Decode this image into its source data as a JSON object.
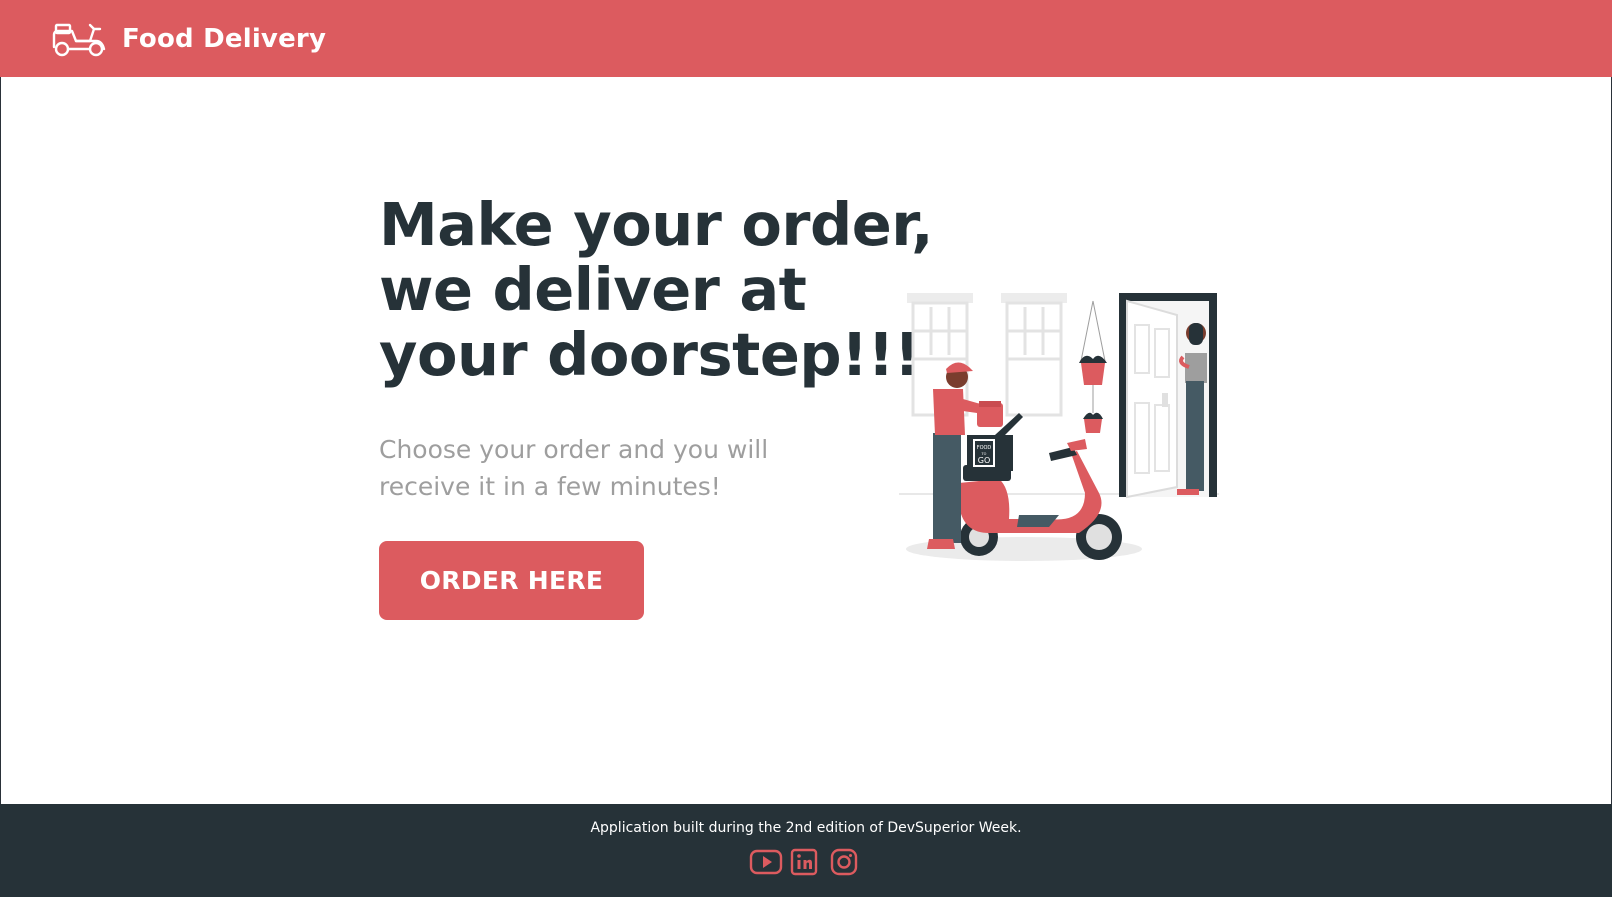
{
  "navbar": {
    "brand": "Food Delivery",
    "logo_icon": "scooter-icon"
  },
  "hero": {
    "title_lines": [
      "Make your order,",
      "we deliver at",
      "your doorstep!!!"
    ],
    "subtitle_lines": [
      "Choose your order and you will",
      "receive it in a few minutes!"
    ],
    "button_label": "ORDER HERE",
    "illustration": {
      "name": "delivery-illustration",
      "sign_text": [
        "FOOD",
        "TO",
        "GO"
      ]
    }
  },
  "footer": {
    "text": "Application built during the 2nd edition of DevSuperior Week.",
    "social_icons": [
      "youtube-icon",
      "linkedin-icon",
      "instagram-icon"
    ]
  },
  "colors": {
    "accent": "#dc5b5f",
    "dark": "#263238",
    "subtitle": "#9e9e9e",
    "background": "#ffffff"
  }
}
